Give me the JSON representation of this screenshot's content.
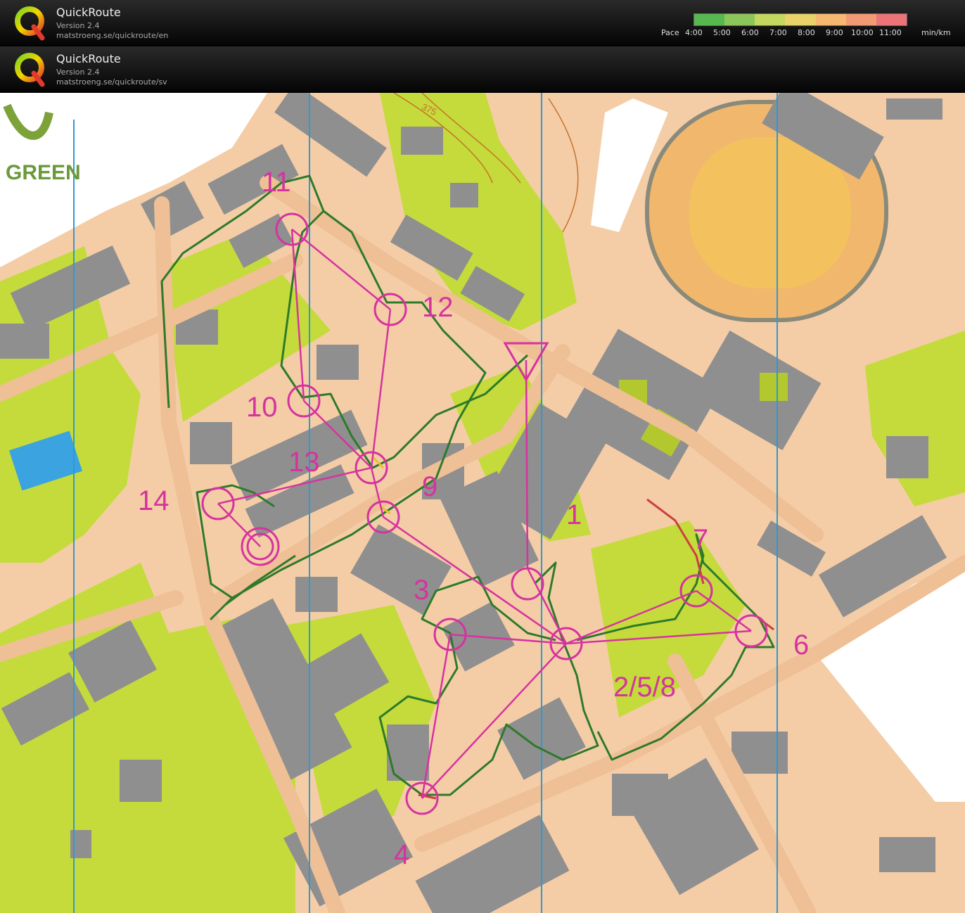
{
  "headers": [
    {
      "title": "QuickRoute",
      "version": "Version 2.4",
      "url": "matstroeng.se/quickroute/en"
    },
    {
      "title": "QuickRoute",
      "version": "Version 2.4",
      "url": "matstroeng.se/quickroute/sv"
    }
  ],
  "pace": {
    "label": "Pace",
    "unit": "min/km",
    "ticks": [
      "4:00",
      "5:00",
      "6:00",
      "7:00",
      "8:00",
      "9:00",
      "10:00",
      "11:00"
    ],
    "colors": [
      "#57b84f",
      "#8cc65a",
      "#c4d860",
      "#e9d26a",
      "#f4b870",
      "#f19a73",
      "#ec7378"
    ]
  },
  "map": {
    "corner_text": "GREEN",
    "contour_label": "375",
    "controls": [
      "1",
      "2/5/8",
      "3",
      "4",
      "6",
      "7",
      "9",
      "10",
      "11",
      "12",
      "13",
      "14"
    ]
  }
}
